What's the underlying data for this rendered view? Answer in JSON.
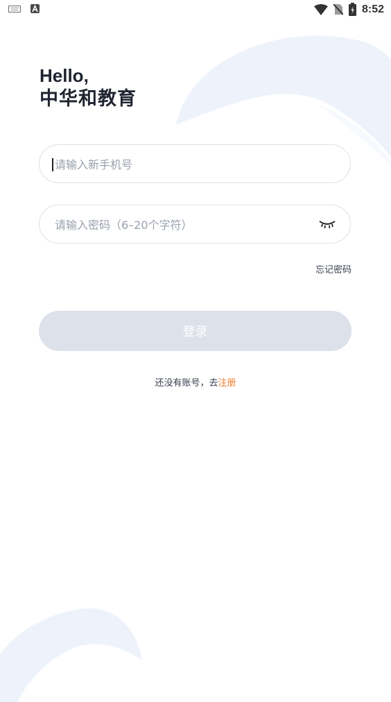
{
  "status_bar": {
    "time": "8:52",
    "icons": [
      "keyboard-icon",
      "a-icon",
      "wifi-icon",
      "no-sim-icon",
      "battery-icon"
    ]
  },
  "greeting": {
    "hello": "Hello,",
    "brand": "中华和教育"
  },
  "phone_field": {
    "value": "",
    "placeholder": "请输入新手机号"
  },
  "password_field": {
    "value": "",
    "placeholder": "请输入密码（6–20个字符）",
    "toggle_icon": "eye-closed-icon"
  },
  "forgot_password": "忘记密码",
  "login_button": "登录",
  "register": {
    "prompt": "还没有账号，去",
    "link": "注册"
  },
  "colors": {
    "accent": "#f07a28",
    "button_disabled": "#dde1ea",
    "decor_wave": "#eef3fb"
  }
}
